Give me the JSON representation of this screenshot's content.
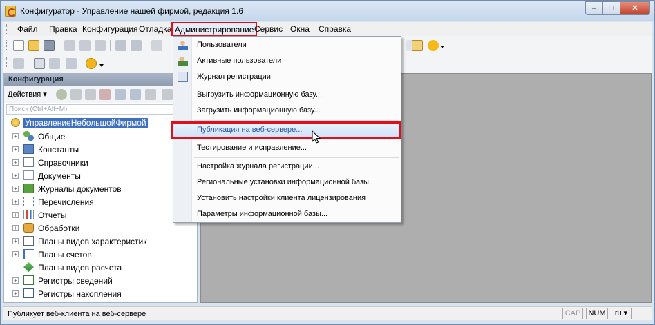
{
  "window": {
    "title": "Конфигуратор - Управление нашей фирмой, редакция 1.6",
    "minimize": "–",
    "maximize": "□",
    "close": "✕"
  },
  "menubar": {
    "items": [
      "Файл",
      "Правка",
      "Конфигурация",
      "Отладка",
      "Администрирование",
      "Сервис",
      "Окна",
      "Справка"
    ],
    "active_index": 4
  },
  "left_panel": {
    "title": "Конфигурация",
    "actions_label": "Действия ▾",
    "search_placeholder": "Поиск (Ctrl+Alt+M)",
    "tree": [
      {
        "label": "УправлениеНебольшойФирмой",
        "icon": "root-config-icon",
        "selected": true
      },
      {
        "label": "Общие",
        "icon": "common-icon"
      },
      {
        "label": "Константы",
        "icon": "constants-icon"
      },
      {
        "label": "Справочники",
        "icon": "catalogs-icon"
      },
      {
        "label": "Документы",
        "icon": "documents-icon"
      },
      {
        "label": "Журналы документов",
        "icon": "document-journals-icon"
      },
      {
        "label": "Перечисления",
        "icon": "enums-icon"
      },
      {
        "label": "Отчеты",
        "icon": "reports-icon"
      },
      {
        "label": "Обработки",
        "icon": "data-processors-icon"
      },
      {
        "label": "Планы видов характеристик",
        "icon": "chart-of-characteristics-icon"
      },
      {
        "label": "Планы счетов",
        "icon": "chart-of-accounts-icon"
      },
      {
        "label": "Планы видов расчета",
        "icon": "chart-of-calculation-icon"
      },
      {
        "label": "Регистры сведений",
        "icon": "information-registers-icon"
      },
      {
        "label": "Регистры накопления",
        "icon": "accumulation-registers-icon"
      }
    ]
  },
  "admin_menu": {
    "items": [
      {
        "label": "Пользователи",
        "icon": "users-icon"
      },
      {
        "label": "Активные пользователи",
        "icon": "active-users-icon"
      },
      {
        "label": "Журнал регистрации",
        "icon": "event-log-icon"
      },
      {
        "label": "Выгрузить информационную базу..."
      },
      {
        "label": "Загрузить информационную базу..."
      },
      {
        "label": "Публикация на веб-сервере...",
        "highlighted": true
      },
      {
        "label": "Тестирование и исправление..."
      },
      {
        "label": "Настройка журнала регистрации..."
      },
      {
        "label": "Региональные установки информационной базы..."
      },
      {
        "label": "Установить настройки клиента лицензирования"
      },
      {
        "label": "Параметры информационной базы..."
      }
    ]
  },
  "statusbar": {
    "text": "Публикует веб-клиента на веб-сервере",
    "cap": "CAP",
    "num": "NUM",
    "lang": "ru ▾"
  },
  "colors": {
    "highlight_border": "#e0101a",
    "selection": "#3f6fc1",
    "workspace": "#aeaeae"
  }
}
